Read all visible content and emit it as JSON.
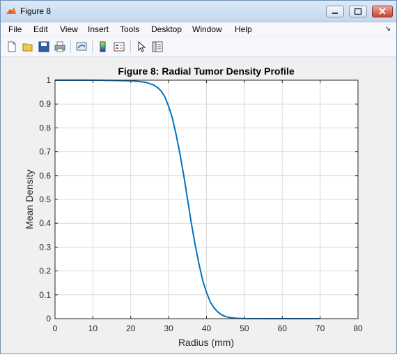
{
  "window": {
    "title": "Figure 8"
  },
  "menu": [
    "File",
    "Edit",
    "View",
    "Insert",
    "Tools",
    "Desktop",
    "Window",
    "Help"
  ],
  "toolbar": {
    "icons": [
      "new-figure-icon",
      "open-file-icon",
      "save-icon",
      "print-icon",
      "link-plot-icon",
      "colorbar-icon",
      "legend-icon",
      "pointer-icon",
      "property-editor-icon"
    ]
  },
  "colors": {
    "line": "#0072bd",
    "grid": "#d9d9d9",
    "axes_bg": "#ffffff",
    "figure_bg": "#f0f0f0"
  },
  "chart_data": {
    "type": "line",
    "title": "Figure 8: Radial Tumor Density Profile",
    "xlabel": "Radius (mm)",
    "ylabel": "Mean Density",
    "xlim": [
      0,
      80
    ],
    "ylim": [
      0,
      1
    ],
    "xticks": [
      "0",
      "10",
      "20",
      "30",
      "40",
      "50",
      "60",
      "70",
      "80"
    ],
    "yticks": [
      "0",
      "0.1",
      "0.2",
      "0.3",
      "0.4",
      "0.5",
      "0.6",
      "0.7",
      "0.8",
      "0.9",
      "1"
    ],
    "grid": true,
    "series": [
      {
        "x": [
          0,
          5,
          10,
          15,
          20,
          22,
          24,
          26,
          27,
          28,
          29,
          30,
          31,
          32,
          33,
          34,
          35,
          36,
          37,
          38,
          39,
          40,
          41,
          42,
          43,
          44,
          45,
          46,
          47,
          48,
          50,
          55,
          60,
          65,
          70
        ],
        "y": [
          1.0,
          1.0,
          1.0,
          0.999,
          0.997,
          0.995,
          0.991,
          0.98,
          0.97,
          0.955,
          0.93,
          0.89,
          0.84,
          0.77,
          0.69,
          0.6,
          0.5,
          0.4,
          0.31,
          0.23,
          0.16,
          0.11,
          0.07,
          0.045,
          0.028,
          0.016,
          0.009,
          0.005,
          0.003,
          0.0015,
          0.0005,
          0.0,
          0.0,
          0.0,
          0.0
        ]
      }
    ]
  }
}
